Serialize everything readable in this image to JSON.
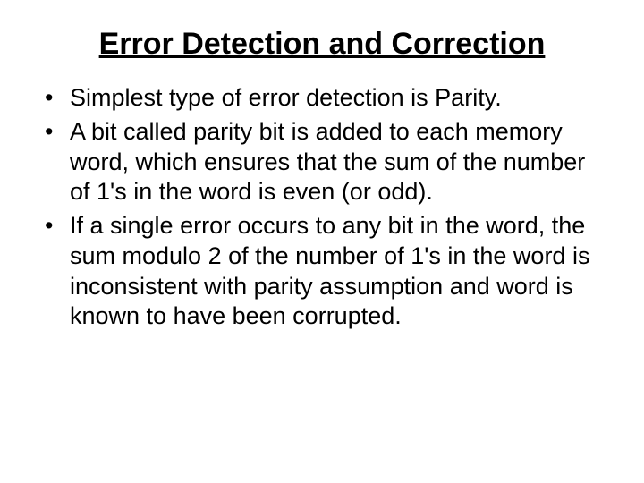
{
  "slide": {
    "title": "Error Detection and Correction",
    "bullets": [
      "Simplest type of error detection is Parity.",
      "A bit called parity bit is added to each memory word, which ensures that the sum of the number of 1's in the word is even (or odd).",
      "If a single error occurs to any bit in the word, the sum modulo 2 of the number of 1's in the word is inconsistent with parity assumption and word is known to have been corrupted."
    ]
  }
}
